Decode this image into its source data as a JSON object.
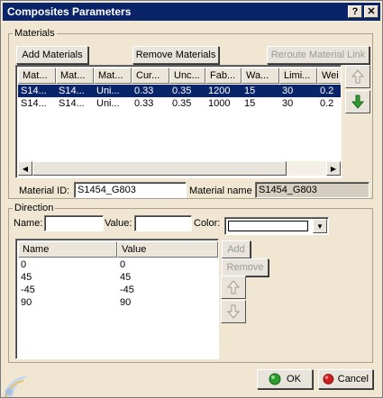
{
  "window": {
    "title": "Composites Parameters"
  },
  "titlebar": {
    "help_label": "?",
    "close_label": "✕"
  },
  "materials": {
    "group_label": "Materials",
    "add_label": "Add Materials",
    "remove_label": "Remove Materials",
    "reroute_label": "Reroute Material Link",
    "columns": [
      "Mat...",
      "Mat...",
      "Mat...",
      "Cur...",
      "Unc...",
      "Fab...",
      "Wa...",
      "Limi...",
      "Wei"
    ],
    "rows": [
      [
        "S14...",
        "S14...",
        "Uni...",
        "0.33",
        "0.35",
        "1200",
        "15",
        "30",
        "0.2"
      ],
      [
        "S14...",
        "S14...",
        "Uni...",
        "0.33",
        "0.35",
        "1000",
        "15",
        "30",
        "0.2"
      ]
    ],
    "selected_row": 0,
    "id_label": "Material ID:",
    "id_value": "S1454_G803",
    "name_label": "Material name :",
    "name_value": "S1454_G803"
  },
  "direction": {
    "group_label": "Direction",
    "name_label": "Name:",
    "name_value": "",
    "value_label": "Value:",
    "value_value": "",
    "color_label": "Color:",
    "columns": [
      "Name",
      "Value"
    ],
    "rows": [
      [
        "0",
        "0"
      ],
      [
        "45",
        "45"
      ],
      [
        "-45",
        "-45"
      ],
      [
        "90",
        "90"
      ]
    ],
    "add_label": "Add",
    "remove_label": "Remove"
  },
  "footer": {
    "ok_label": "OK",
    "cancel_label": "Cancel"
  },
  "colors": {
    "title_bg": "#0a2469",
    "selection": "#0a2469",
    "ok_icon": "#2e9b2e",
    "cancel_icon": "#cc2020",
    "down_arrow": "#2e9b2e"
  }
}
